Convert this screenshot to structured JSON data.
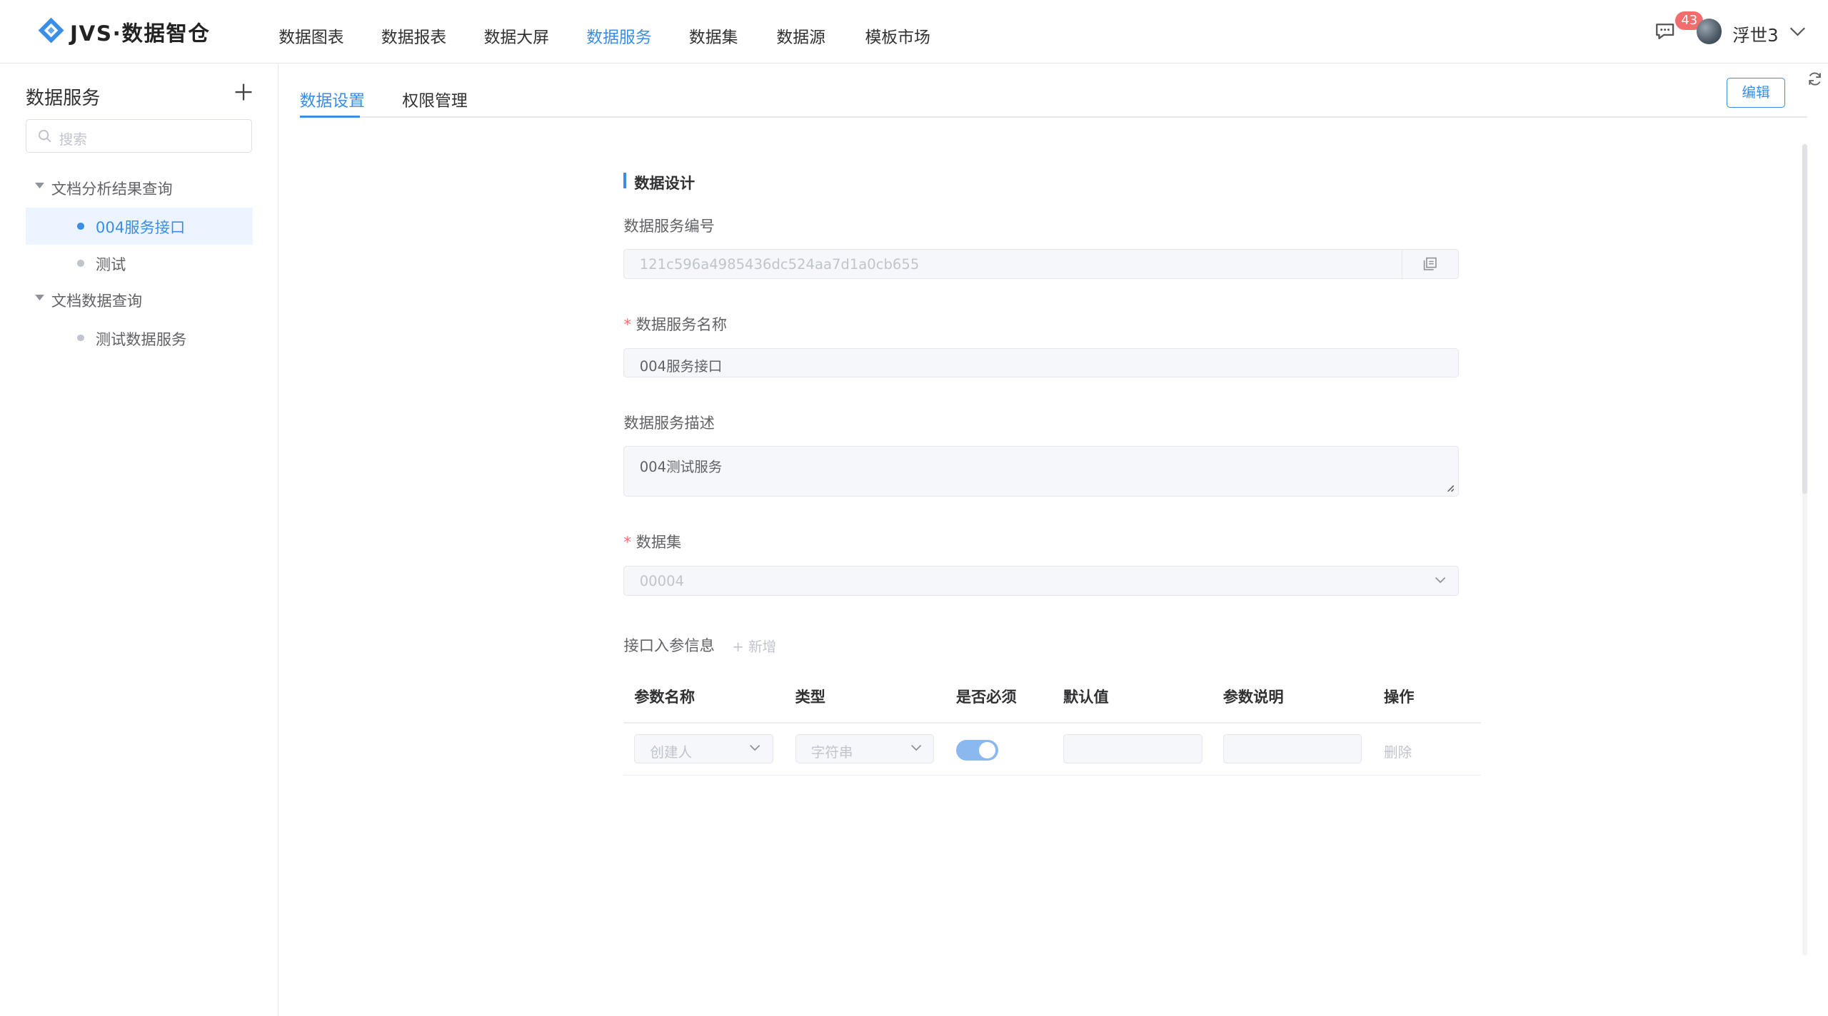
{
  "header": {
    "logo_text": "JVS·数据智仓",
    "nav": [
      "数据图表",
      "数据报表",
      "数据大屏",
      "数据服务",
      "数据集",
      "数据源",
      "模板市场"
    ],
    "active_nav": "数据服务",
    "message_badge": "43",
    "username": "浮世3"
  },
  "sidebar": {
    "title": "数据服务",
    "search_placeholder": "搜索",
    "tree": [
      {
        "label": "文档分析结果查询",
        "children": [
          "004服务接口",
          "测试"
        ]
      },
      {
        "label": "文档数据查询",
        "children": [
          "测试数据服务"
        ]
      }
    ],
    "selected": "004服务接口"
  },
  "main": {
    "tabs": [
      "数据设置",
      "权限管理"
    ],
    "active_tab": "数据设置",
    "edit_label": "编辑",
    "section_title": "数据设计",
    "fields": {
      "id_label": "数据服务编号",
      "id_value": "121c596a4985436dc524aa7d1a0cb655",
      "name_label": "数据服务名称",
      "name_value": "004服务接口",
      "desc_label": "数据服务描述",
      "desc_value": "004测试服务",
      "dataset_label": "数据集",
      "dataset_value": "00004"
    },
    "params": {
      "label": "接口入参信息",
      "add_label": "新增",
      "columns": [
        "参数名称",
        "类型",
        "是否必须",
        "默认值",
        "参数说明",
        "操作"
      ],
      "row": {
        "name": "创建人",
        "type": "字符串",
        "required": true,
        "default": "",
        "desc": "",
        "action": "删除"
      }
    }
  },
  "colors": {
    "accent": "#3a8ee6",
    "required": "#f56c6c",
    "badge": "#f56c6c"
  }
}
